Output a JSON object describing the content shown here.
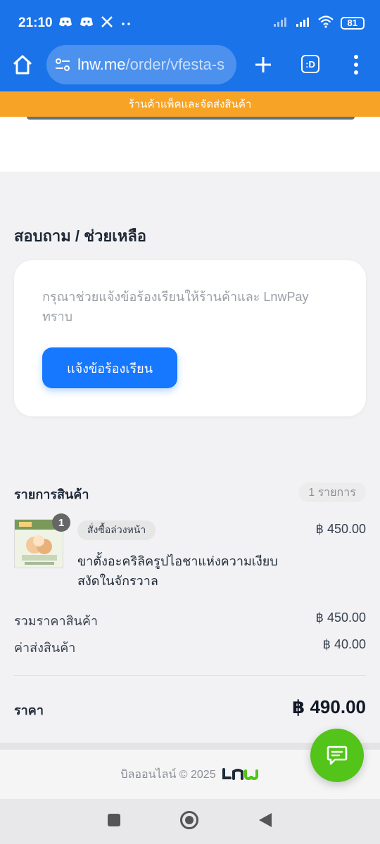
{
  "status_bar": {
    "time": "21:10",
    "battery": "81",
    "icons": [
      "discord-icon",
      "discord-icon",
      "x-icon",
      "more-dots-icon",
      "signal-icon",
      "wifi-icon",
      "battery-icon"
    ]
  },
  "browser": {
    "url_host": "lnw.me",
    "url_path": "/order/vfesta-s",
    "tabs_label": ":D"
  },
  "banner": {
    "text": "ร้านค้าแพ็คและจัดส่งสินค้า"
  },
  "help": {
    "title": "สอบถาม / ช่วยเหลือ",
    "description": "กรุณาช่วยแจ้งข้อร้องเรียนให้ร้านค้าและ LnwPay ทราบ",
    "button_label": "แจ้งข้อร้องเรียน"
  },
  "items": {
    "heading": "รายการสินค้า",
    "count_label": "1 รายการ",
    "list": [
      {
        "quantity": "1",
        "tag": "สั่งซื้อล่วงหน้า",
        "name": "ขาตั้งอะคริลิครูปไอชาแห่งความเงียบสงัดในจักรวาล",
        "price": "฿ 450.00"
      }
    ]
  },
  "summary": {
    "subtotal_label": "รวมราคาสินค้า",
    "subtotal_value": "฿ 450.00",
    "shipping_label": "ค่าส่งสินค้า",
    "shipping_value": "฿ 40.00",
    "total_label": "ราคา",
    "total_value": "฿ 490.00"
  },
  "footer": {
    "text": "บิลออนไลน์ © 2025"
  },
  "colors": {
    "browser_blue": "#1a73e8",
    "banner_orange": "#f7a325",
    "primary_button": "#1677ff",
    "chat_green": "#52c41a"
  }
}
